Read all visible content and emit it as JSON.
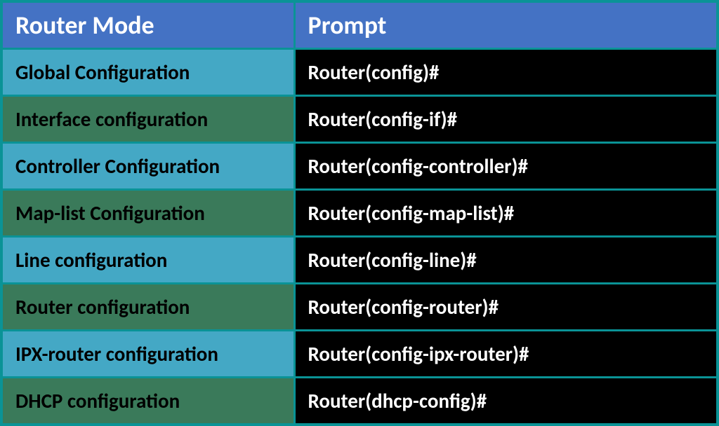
{
  "header": {
    "col1": "Router Mode",
    "col2": "Prompt"
  },
  "rows": [
    {
      "mode": "Global Configuration",
      "prompt": "Router(config)#"
    },
    {
      "mode": "Interface configuration",
      "prompt": "Router(config-if)#"
    },
    {
      "mode": "Controller Configuration",
      "prompt": "Router(config-controller)#"
    },
    {
      "mode": "Map-list Configuration",
      "prompt": "Router(config-map-list)#"
    },
    {
      "mode": "Line configuration",
      "prompt": "Router(config-line)#"
    },
    {
      "mode": "Router configuration",
      "prompt": "Router(config-router)#"
    },
    {
      "mode": "IPX-router configuration",
      "prompt": "Router(config-ipx-router)#"
    },
    {
      "mode": "DHCP configuration",
      "prompt": "Router(dhcp-config)#"
    }
  ]
}
